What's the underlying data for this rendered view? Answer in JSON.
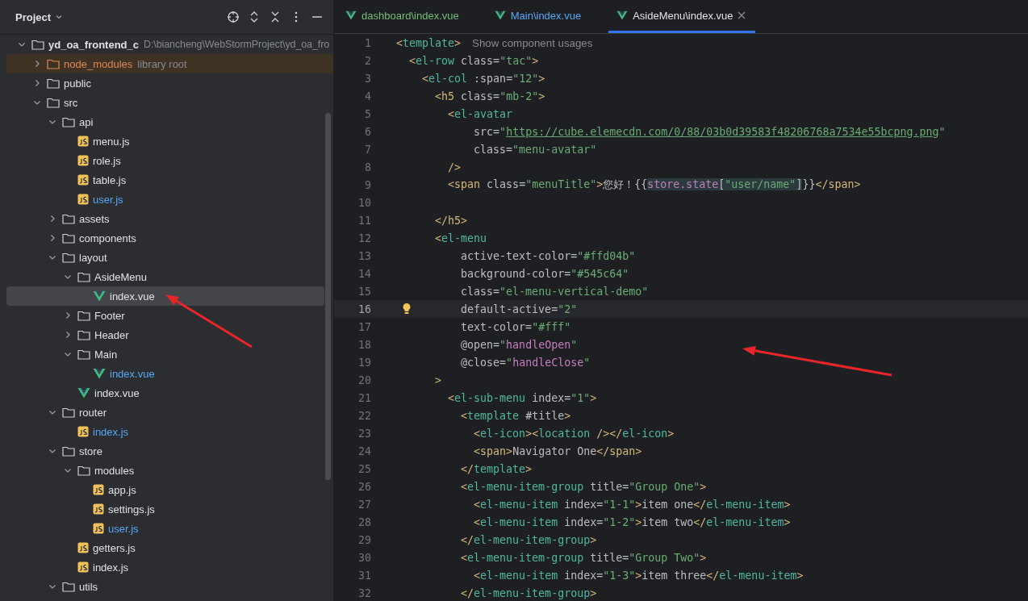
{
  "panel": {
    "title": "Project"
  },
  "tree": [
    {
      "label": "yd_oa_frontend_c",
      "kind": "project",
      "hint": "D:\\biancheng\\WebStormProject\\yd_oa_fro",
      "color": "#dfe1e5",
      "selected": false,
      "expanded": true,
      "children": [
        {
          "label": "node_modules",
          "kind": "library",
          "hint": "library root",
          "color": "#e08855",
          "selected": false,
          "expanded": false
        },
        {
          "label": "public",
          "kind": "folder",
          "color": "#dfe1e5",
          "selected": false,
          "expanded": false
        },
        {
          "label": "src",
          "kind": "folder",
          "color": "#dfe1e5",
          "selected": false,
          "expanded": true,
          "children": [
            {
              "label": "api",
              "kind": "folder",
              "color": "#dfe1e5",
              "selected": false,
              "expanded": true,
              "children": [
                {
                  "label": "menu.js",
                  "kind": "js",
                  "color": "#dfe1e5",
                  "selected": false
                },
                {
                  "label": "role.js",
                  "kind": "js",
                  "color": "#dfe1e5",
                  "selected": false
                },
                {
                  "label": "table.js",
                  "kind": "js",
                  "color": "#dfe1e5",
                  "selected": false
                },
                {
                  "label": "user.js",
                  "kind": "js",
                  "color": "#56a8f5",
                  "selected": false
                }
              ]
            },
            {
              "label": "assets",
              "kind": "folder",
              "color": "#dfe1e5",
              "selected": false,
              "expanded": false
            },
            {
              "label": "components",
              "kind": "folder",
              "color": "#dfe1e5",
              "selected": false,
              "expanded": false
            },
            {
              "label": "layout",
              "kind": "folder",
              "color": "#dfe1e5",
              "selected": false,
              "expanded": true,
              "children": [
                {
                  "label": "AsideMenu",
                  "kind": "folder",
                  "color": "#dfe1e5",
                  "selected": false,
                  "expanded": true,
                  "children": [
                    {
                      "label": "index.vue",
                      "kind": "vue",
                      "color": "#dfe1e5",
                      "selected": true
                    }
                  ]
                },
                {
                  "label": "Footer",
                  "kind": "folder",
                  "color": "#dfe1e5",
                  "selected": false,
                  "expanded": false
                },
                {
                  "label": "Header",
                  "kind": "folder",
                  "color": "#dfe1e5",
                  "selected": false,
                  "expanded": false
                },
                {
                  "label": "Main",
                  "kind": "folder",
                  "color": "#dfe1e5",
                  "selected": false,
                  "expanded": true,
                  "children": [
                    {
                      "label": "index.vue",
                      "kind": "vue",
                      "color": "#56a8f5",
                      "selected": false
                    }
                  ]
                },
                {
                  "label": "index.vue",
                  "kind": "vue",
                  "color": "#dfe1e5",
                  "selected": false
                }
              ]
            },
            {
              "label": "router",
              "kind": "folder",
              "color": "#dfe1e5",
              "selected": false,
              "expanded": true,
              "children": [
                {
                  "label": "index.js",
                  "kind": "js",
                  "color": "#56a8f5",
                  "selected": false
                }
              ]
            },
            {
              "label": "store",
              "kind": "folder",
              "color": "#dfe1e5",
              "selected": false,
              "expanded": true,
              "children": [
                {
                  "label": "modules",
                  "kind": "folder",
                  "color": "#dfe1e5",
                  "selected": false,
                  "expanded": true,
                  "children": [
                    {
                      "label": "app.js",
                      "kind": "js",
                      "color": "#dfe1e5",
                      "selected": false
                    },
                    {
                      "label": "settings.js",
                      "kind": "js",
                      "color": "#dfe1e5",
                      "selected": false
                    },
                    {
                      "label": "user.js",
                      "kind": "js",
                      "color": "#56a8f5",
                      "selected": false
                    }
                  ]
                },
                {
                  "label": "getters.js",
                  "kind": "js",
                  "color": "#dfe1e5",
                  "selected": false
                },
                {
                  "label": "index.js",
                  "kind": "js",
                  "color": "#dfe1e5",
                  "selected": false
                }
              ]
            },
            {
              "label": "utils",
              "kind": "folder",
              "color": "#dfe1e5",
              "selected": false,
              "expanded": true
            }
          ]
        }
      ]
    }
  ],
  "tabs": [
    {
      "label": "dashboard\\index.vue",
      "color": "#73bd79",
      "selected": false
    },
    {
      "label": "Main\\index.vue",
      "color": "#56a8f5",
      "selected": false
    },
    {
      "label": "AsideMenu\\index.vue",
      "color": "#dfe1e5",
      "selected": true
    }
  ],
  "lines": [
    {
      "number": "1",
      "current": false,
      "text": "<template>",
      "hint": "Show component usages"
    },
    {
      "number": "2",
      "current": false,
      "text": "  <el-row class=\"tac\">"
    },
    {
      "number": "3",
      "current": false,
      "text": "    <el-col :span=\"12\">"
    },
    {
      "number": "4",
      "current": false,
      "text": "      <h5 class=\"mb-2\">"
    },
    {
      "number": "5",
      "current": false,
      "text": "        <el-avatar"
    },
    {
      "number": "6",
      "current": false,
      "text": "            src=\"https://cube.elemecdn.com/0/88/03b0d39583f48206768a7534e55bcpng.png\""
    },
    {
      "number": "7",
      "current": false,
      "text": "            class=\"menu-avatar\""
    },
    {
      "number": "8",
      "current": false,
      "text": "        />"
    },
    {
      "number": "9",
      "current": false,
      "text": "        <span class=\"menuTitle\">您好！{{store.state[\"user/name\"]}}</span>"
    },
    {
      "number": "10",
      "current": false
    },
    {
      "number": "11",
      "current": false,
      "text": "      </h5>"
    },
    {
      "number": "12",
      "current": false,
      "text": "      <el-menu"
    },
    {
      "number": "13",
      "current": false,
      "text": "          active-text-color=\"#ffd04b\""
    },
    {
      "number": "14",
      "current": false,
      "text": "          background-color=\"#545c64\""
    },
    {
      "number": "15",
      "current": false,
      "text": "          class=\"el-menu-vertical-demo\""
    },
    {
      "number": "16",
      "current": true,
      "text": "          default-active=\"2\""
    },
    {
      "number": "17",
      "current": false,
      "text": "          text-color=\"#fff\""
    },
    {
      "number": "18",
      "current": false,
      "text": "          @open=\"handleOpen\""
    },
    {
      "number": "19",
      "current": false,
      "text": "          @close=\"handleClose\""
    },
    {
      "number": "20",
      "current": false,
      "text": "      >"
    },
    {
      "number": "21",
      "current": false,
      "text": "        <el-sub-menu index=\"1\">"
    },
    {
      "number": "22",
      "current": false,
      "text": "          <template #title>"
    },
    {
      "number": "23",
      "current": false,
      "text": "            <el-icon><location /></el-icon>"
    },
    {
      "number": "24",
      "current": false,
      "text": "            <span>Navigator One</span>"
    },
    {
      "number": "25",
      "current": false,
      "text": "          </template>"
    },
    {
      "number": "26",
      "current": false,
      "text": "          <el-menu-item-group title=\"Group One\">"
    },
    {
      "number": "27",
      "current": false,
      "text": "            <el-menu-item index=\"1-1\">item one</el-menu-item>"
    },
    {
      "number": "28",
      "current": false,
      "text": "            <el-menu-item index=\"1-2\">item two</el-menu-item>"
    },
    {
      "number": "29",
      "current": false,
      "text": "          </el-menu-item-group>"
    },
    {
      "number": "30",
      "current": false,
      "text": "          <el-menu-item-group title=\"Group Two\">"
    },
    {
      "number": "31",
      "current": false,
      "text": "            <el-menu-item index=\"1-3\">item three</el-menu-item>"
    },
    {
      "number": "32",
      "current": false,
      "text": "          </el-menu-item-group>"
    }
  ]
}
